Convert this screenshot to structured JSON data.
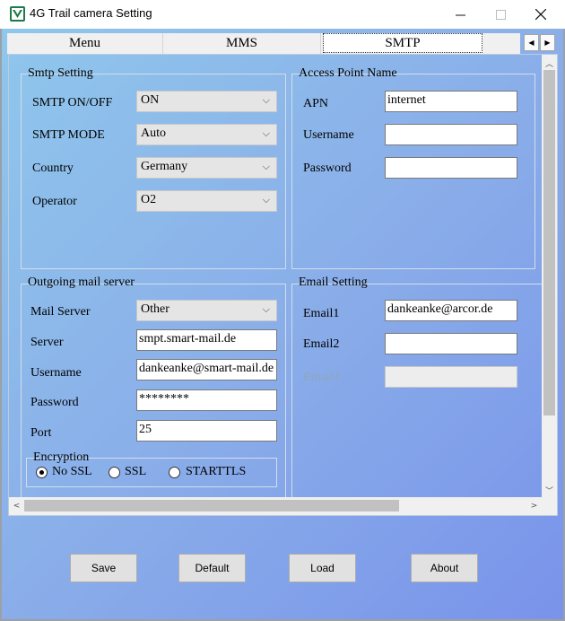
{
  "window": {
    "title": "4G Trail camera Setting"
  },
  "tabs": [
    {
      "label": "Menu"
    },
    {
      "label": "MMS"
    },
    {
      "label": "SMTP",
      "selected": true
    }
  ],
  "smtp_setting": {
    "title": "Smtp Setting",
    "fields": [
      {
        "label": "SMTP ON/OFF",
        "value": "ON"
      },
      {
        "label": "SMTP MODE",
        "value": "Auto"
      },
      {
        "label": "Country",
        "value": "Germany"
      },
      {
        "label": "Operator",
        "value": "O2"
      }
    ]
  },
  "access_point": {
    "title": "Access Point Name",
    "fields": [
      {
        "label": "APN",
        "value": "internet"
      },
      {
        "label": "Username",
        "value": ""
      },
      {
        "label": "Password",
        "value": ""
      }
    ]
  },
  "outgoing_mail": {
    "title": "Outgoing mail server",
    "mail_server": {
      "label": "Mail Server",
      "value": "Other"
    },
    "server": {
      "label": "Server",
      "value": "smpt.smart-mail.de"
    },
    "username": {
      "label": "Username",
      "value": "dankeanke@smart-mail.de"
    },
    "password": {
      "label": "Password",
      "value": "********"
    },
    "port": {
      "label": "Port",
      "value": "25"
    },
    "encryption": {
      "title": "Encryption",
      "options": [
        {
          "label": "No SSL",
          "checked": true
        },
        {
          "label": "SSL",
          "checked": false
        },
        {
          "label": "STARTTLS",
          "checked": false
        }
      ]
    }
  },
  "email_setting": {
    "title": "Email Setting",
    "fields": [
      {
        "label": "Email1",
        "value": "dankeanke@arcor.de"
      },
      {
        "label": "Email2",
        "value": ""
      },
      {
        "label": "Email3",
        "value": "",
        "disabled": true
      }
    ]
  },
  "buttons": {
    "save": "Save",
    "default": "Default",
    "load": "Load",
    "about": "About"
  },
  "icons": {
    "app": "app-logo-icon",
    "minimize": "minimize-icon",
    "maximize": "maximize-icon",
    "close": "close-icon",
    "dropdown": "chevron-down-icon",
    "tab_scroll_left": "triangle-left-icon",
    "tab_scroll_right": "triangle-right-icon"
  },
  "colors": {
    "background_start": "#8fc7ec",
    "background_end": "#7993ea",
    "app_icon": "#1e7a4a"
  }
}
